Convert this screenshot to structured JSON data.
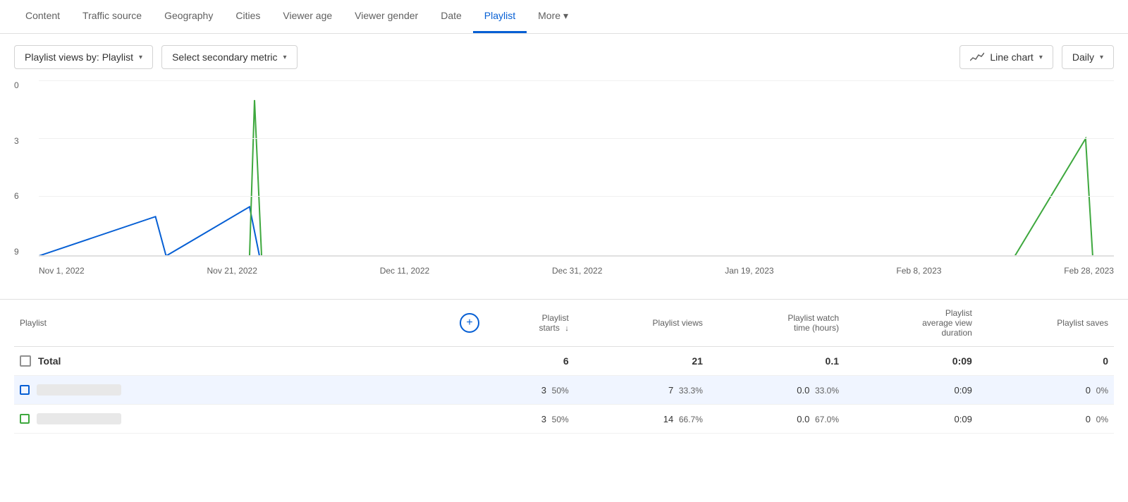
{
  "nav": {
    "tabs": [
      {
        "id": "content",
        "label": "Content",
        "active": false
      },
      {
        "id": "traffic-source",
        "label": "Traffic source",
        "active": false
      },
      {
        "id": "geography",
        "label": "Geography",
        "active": false
      },
      {
        "id": "cities",
        "label": "Cities",
        "active": false
      },
      {
        "id": "viewer-age",
        "label": "Viewer age",
        "active": false
      },
      {
        "id": "viewer-gender",
        "label": "Viewer gender",
        "active": false
      },
      {
        "id": "date",
        "label": "Date",
        "active": false
      },
      {
        "id": "playlist",
        "label": "Playlist",
        "active": true
      },
      {
        "id": "more",
        "label": "More",
        "active": false
      }
    ]
  },
  "toolbar": {
    "primary_metric": "Playlist views by: Playlist",
    "secondary_metric_placeholder": "Select secondary metric",
    "chart_type": "Line chart",
    "period": "Daily"
  },
  "chart": {
    "y_labels": [
      "0",
      "3",
      "6",
      "9"
    ],
    "x_labels": [
      "Nov 1, 2022",
      "Nov 21, 2022",
      "Dec 11, 2022",
      "Dec 31, 2022",
      "Jan 19, 2023",
      "Feb 8, 2023",
      "Feb 28, 2023"
    ],
    "grid_lines": [
      0,
      33,
      66,
      100
    ]
  },
  "table": {
    "add_metric_title": "+",
    "columns": [
      {
        "id": "playlist",
        "label": "Playlist",
        "align": "left"
      },
      {
        "id": "playlist-starts",
        "label": "Playlist starts",
        "sort": "desc",
        "align": "right"
      },
      {
        "id": "playlist-views",
        "label": "Playlist views",
        "align": "right"
      },
      {
        "id": "playlist-watch-time",
        "label": "Playlist watch time (hours)",
        "align": "right"
      },
      {
        "id": "playlist-avg-duration",
        "label": "Playlist average view duration",
        "align": "right"
      },
      {
        "id": "playlist-saves",
        "label": "Playlist saves",
        "align": "right"
      }
    ],
    "rows": [
      {
        "type": "total",
        "name": "Total",
        "playlist_starts": "6",
        "playlist_starts_pct": "",
        "playlist_views": "21",
        "playlist_views_pct": "",
        "watch_time": "0.1",
        "watch_time_pct": "",
        "avg_duration": "0:09",
        "saves": "0",
        "saves_pct": ""
      },
      {
        "type": "data",
        "color": "blue",
        "playlist_starts": "3",
        "playlist_starts_pct": "50%",
        "playlist_views": "7",
        "playlist_views_pct": "33.3%",
        "watch_time": "0.0",
        "watch_time_pct": "33.0%",
        "avg_duration": "0:09",
        "saves": "0",
        "saves_pct": "0%"
      },
      {
        "type": "data",
        "color": "green",
        "playlist_starts": "3",
        "playlist_starts_pct": "50%",
        "playlist_views": "14",
        "playlist_views_pct": "66.7%",
        "watch_time": "0.0",
        "watch_time_pct": "67.0%",
        "avg_duration": "0:09",
        "saves": "0",
        "saves_pct": "0%"
      }
    ]
  }
}
